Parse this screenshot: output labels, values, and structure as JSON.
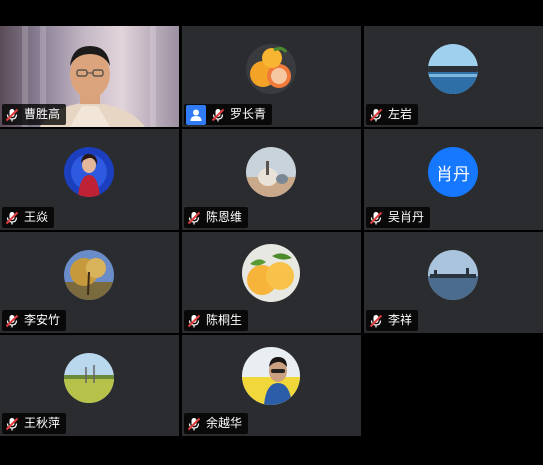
{
  "participants": [
    {
      "name": "曹胜高",
      "avatar_type": "video",
      "mic": "muted"
    },
    {
      "name": "罗长青",
      "avatar_type": "photo",
      "avatar_subject": "oranges",
      "badge": "person-icon",
      "mic": "muted"
    },
    {
      "name": "左岩",
      "avatar_type": "photo",
      "avatar_subject": "lake",
      "mic": "muted"
    },
    {
      "name": "王焱",
      "avatar_type": "photo",
      "avatar_subject": "portrait-blue",
      "mic": "muted"
    },
    {
      "name": "陈恩维",
      "avatar_type": "photo",
      "avatar_subject": "landscape-rocks",
      "mic": "muted"
    },
    {
      "name": "吴肖丹",
      "avatar_type": "text",
      "avatar_text": "肖丹",
      "mic": "muted"
    },
    {
      "name": "李安竹",
      "avatar_type": "photo",
      "avatar_subject": "autumn-tree",
      "mic": "muted"
    },
    {
      "name": "陈桐生",
      "avatar_type": "photo",
      "avatar_subject": "peaches",
      "mic": "muted"
    },
    {
      "name": "李祥",
      "avatar_type": "photo",
      "avatar_subject": "pier",
      "mic": "muted"
    },
    {
      "name": "王秋萍",
      "avatar_type": "photo",
      "avatar_subject": "field",
      "mic": "muted"
    },
    {
      "name": "余越华",
      "avatar_type": "photo",
      "avatar_subject": "person-yellow",
      "mic": "muted"
    }
  ],
  "colors": {
    "tile_bg": "#2b2c2f",
    "nameplate_bg": "#000000",
    "accent": "#1677ff",
    "mic_muted": "#e03c3c"
  }
}
